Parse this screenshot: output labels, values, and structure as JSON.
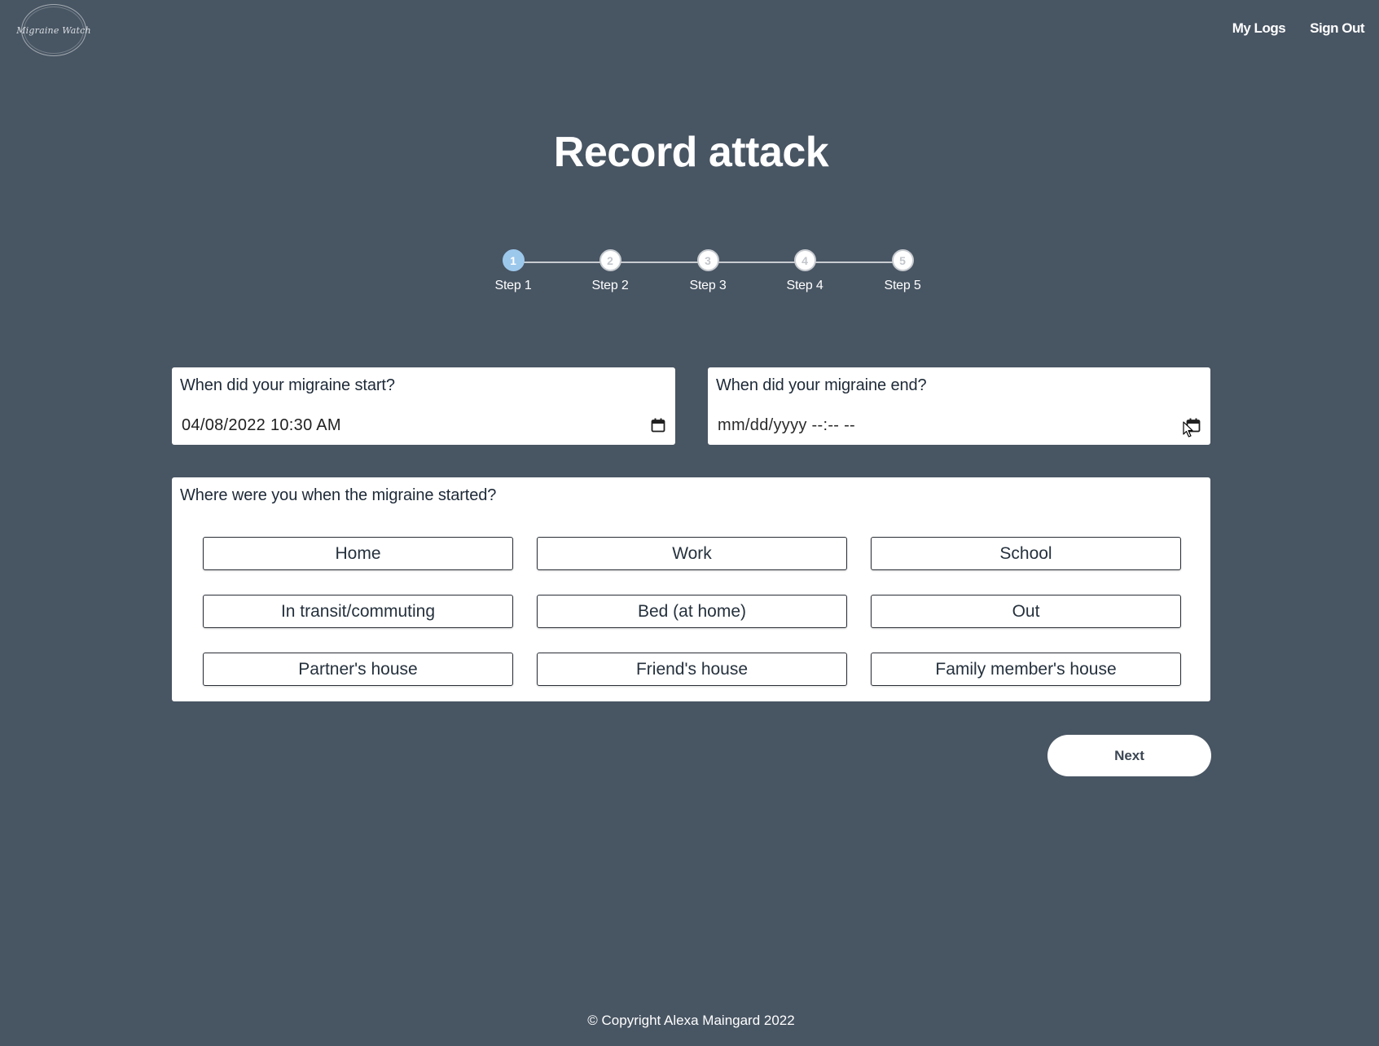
{
  "header": {
    "logo_text": "Migraine Watch",
    "nav": [
      {
        "label": "My Logs"
      },
      {
        "label": "Sign Out"
      }
    ]
  },
  "page": {
    "title": "Record attack"
  },
  "stepper": {
    "current_step": 1,
    "steps": [
      {
        "number": "1",
        "label": "Step 1"
      },
      {
        "number": "2",
        "label": "Step 2"
      },
      {
        "number": "3",
        "label": "Step 3"
      },
      {
        "number": "4",
        "label": "Step 4"
      },
      {
        "number": "5",
        "label": "Step 5"
      }
    ]
  },
  "form": {
    "start": {
      "label": "When did your migraine start?",
      "value": "04/08/2022 10:30 AM"
    },
    "end": {
      "label": "When did your migraine end?",
      "placeholder": "mm/dd/yyyy --:-- --"
    },
    "location": {
      "label": "Where were you when the migraine started?",
      "options": [
        "Home",
        "Work",
        "School",
        "In transit/commuting",
        "Bed (at home)",
        "Out",
        "Partner's house",
        "Friend's house",
        "Family member's house"
      ]
    },
    "next_label": "Next"
  },
  "footer": {
    "copyright": "© Copyright Alexa Maingard 2022"
  },
  "colors": {
    "background": "#485563",
    "active_step": "#9cc8ec",
    "card": "#ffffff"
  }
}
